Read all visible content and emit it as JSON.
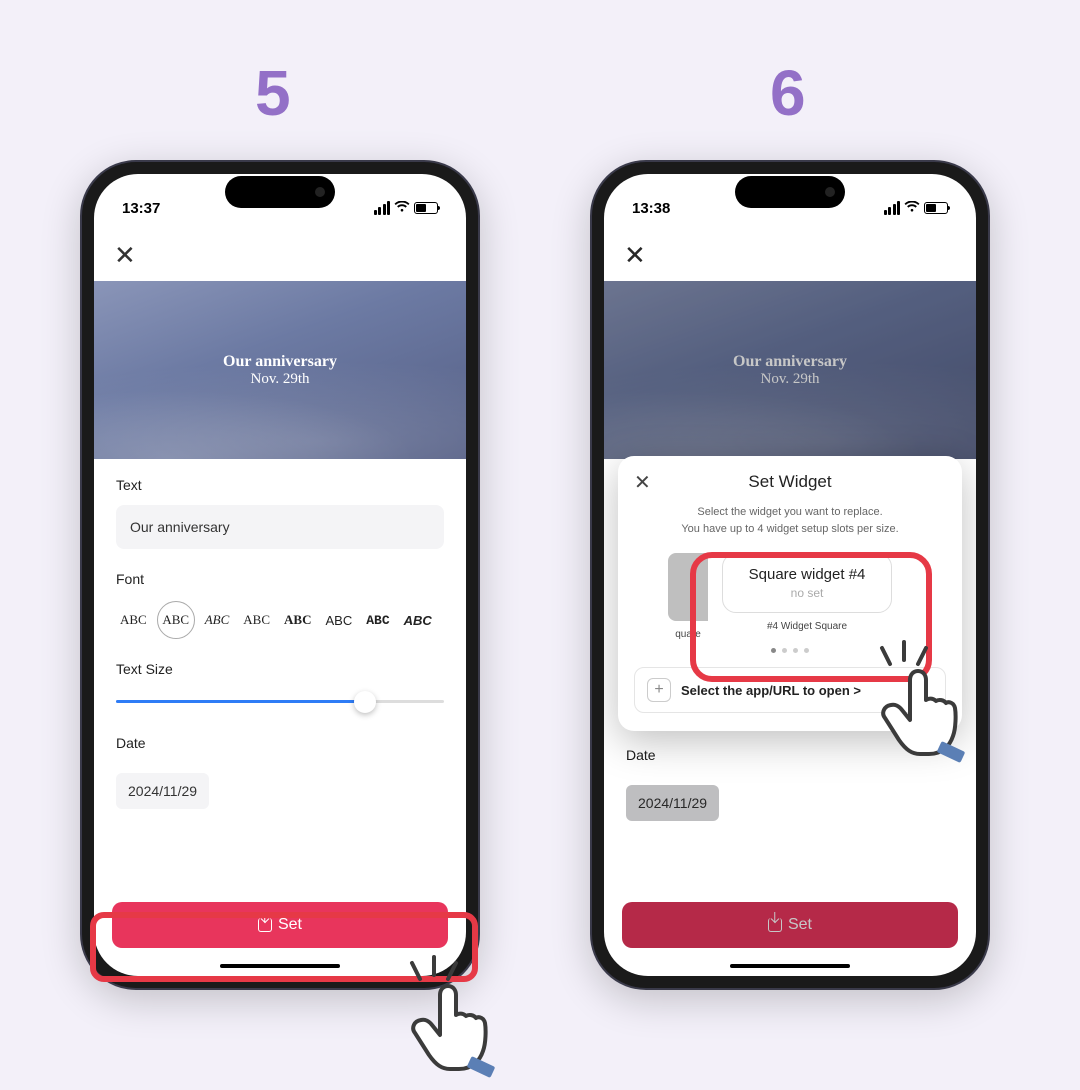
{
  "steps": {
    "s5": "5",
    "s6": "6"
  },
  "phone1": {
    "time": "13:37",
    "hero_title": "Our anniversary",
    "hero_sub": "Nov. 29th",
    "labels": {
      "text": "Text",
      "font": "Font",
      "textsize": "Text Size",
      "date": "Date"
    },
    "text_value": "Our anniversary",
    "fonts": [
      "ABC",
      "ABC",
      "ABC",
      "ABC",
      "ABC",
      "ABC",
      "ABC",
      "ABC"
    ],
    "date_value": "2024/11/29",
    "set_label": "Set"
  },
  "phone2": {
    "time": "13:38",
    "hero_title": "Our anniversary",
    "hero_sub": "Nov. 29th",
    "labels": {
      "date": "Date"
    },
    "date_value": "2024/11/29",
    "set_label": "Set",
    "modal": {
      "title": "Set Widget",
      "desc1": "Select the widget you want to replace.",
      "desc2": "You have up to 4 widget setup slots per size.",
      "left_caption": "quare",
      "card_title": "Square widget #4",
      "card_sub": "no set",
      "card_caption": "#4 Widget Square",
      "select_label": "Select the app/URL to open >"
    }
  }
}
